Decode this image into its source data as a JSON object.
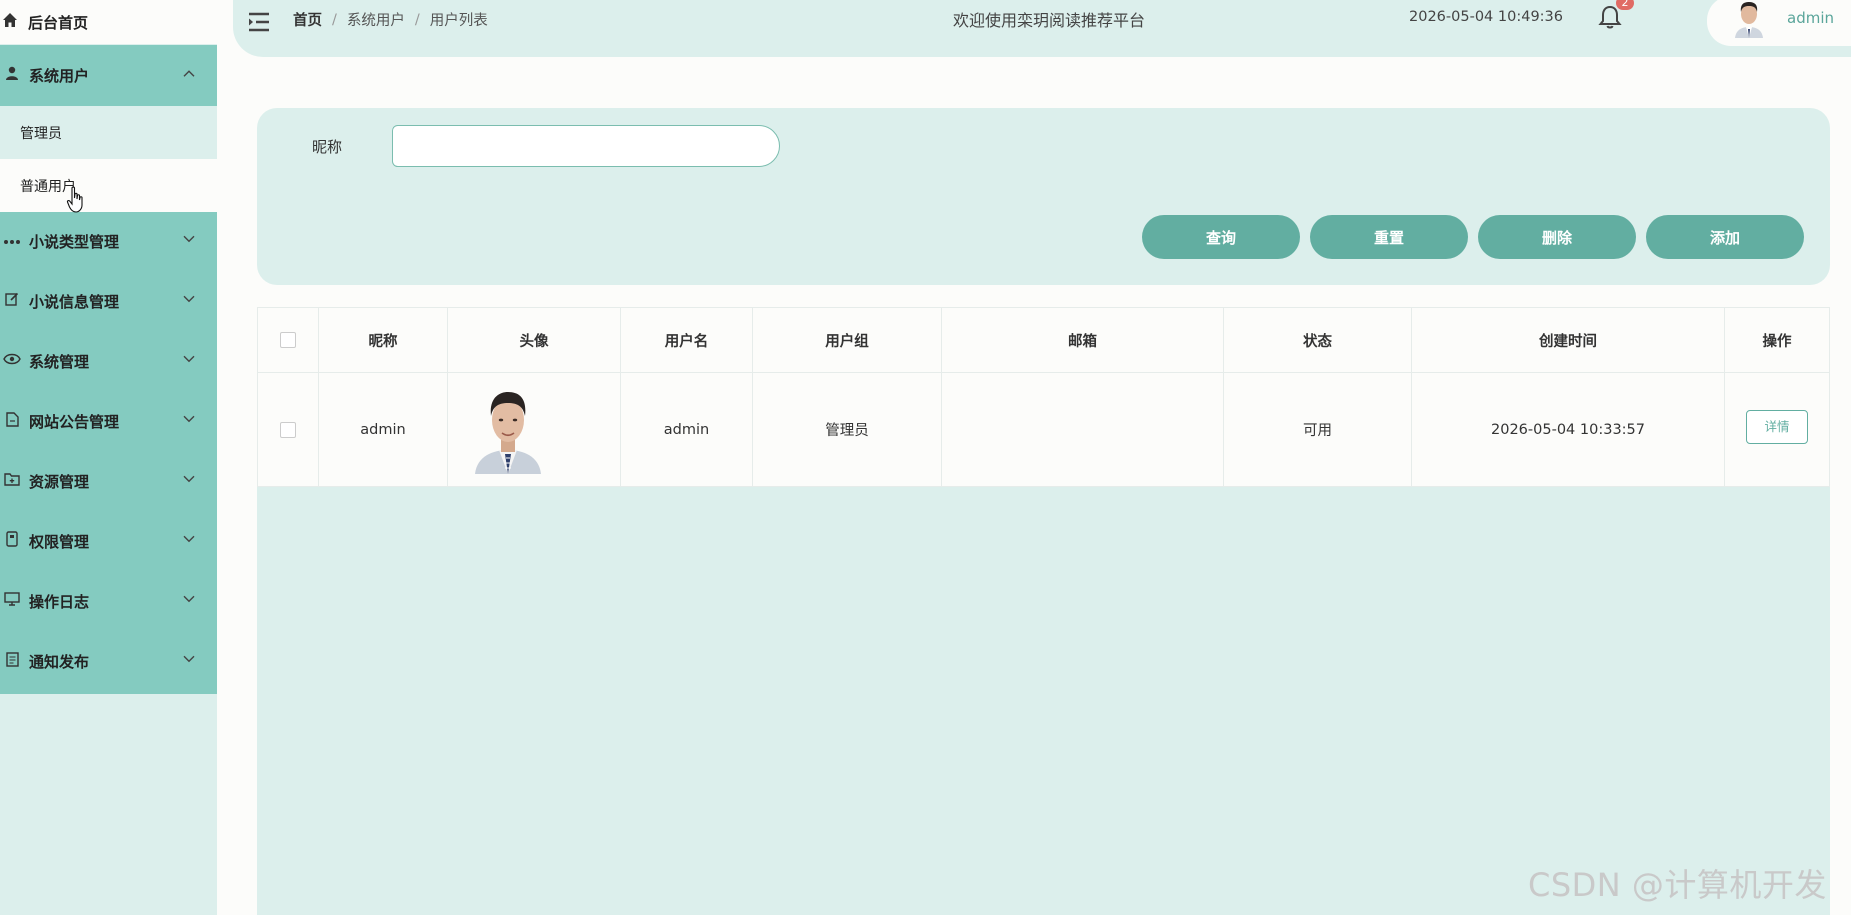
{
  "sidebar": {
    "home": "后台首页",
    "group_open": "系统用户",
    "sub_items": [
      "管理员",
      "普通用户"
    ],
    "items": [
      {
        "label": "小说类型管理",
        "icon": "more-dots-icon"
      },
      {
        "label": "小说信息管理",
        "icon": "edit-icon"
      },
      {
        "label": "系统管理",
        "icon": "eye-icon"
      },
      {
        "label": "网站公告管理",
        "icon": "document-icon"
      },
      {
        "label": "资源管理",
        "icon": "folder-add-icon"
      },
      {
        "label": "权限管理",
        "icon": "tablet-icon"
      },
      {
        "label": "操作日志",
        "icon": "monitor-icon"
      },
      {
        "label": "通知发布",
        "icon": "notice-icon"
      }
    ]
  },
  "header": {
    "breadcrumb": [
      "首页",
      "系统用户",
      "用户列表"
    ],
    "breadcrumb_sep": "/",
    "title": "欢迎使用栾玥阅读推荐平台",
    "datetime": "2026-05-04 10:49:36",
    "notification_count": "2",
    "username": "admin"
  },
  "search": {
    "label": "昵称",
    "value": "",
    "buttons": {
      "query": "查询",
      "reset": "重置",
      "delete": "删除",
      "add": "添加"
    }
  },
  "table": {
    "columns": [
      "昵称",
      "头像",
      "用户名",
      "用户组",
      "邮箱",
      "状态",
      "创建时间",
      "操作"
    ],
    "rows": [
      {
        "nickname": "admin",
        "username": "admin",
        "group": "管理员",
        "email": "",
        "status": "可用",
        "created": "2026-05-04 10:33:57",
        "action": "详情"
      }
    ]
  },
  "watermark": "CSDN @计算机开发",
  "colors": {
    "accent": "#62aea1",
    "sidebar_menu": "#84cbc0",
    "panel": "#dcefec",
    "badge": "#e06b64"
  }
}
